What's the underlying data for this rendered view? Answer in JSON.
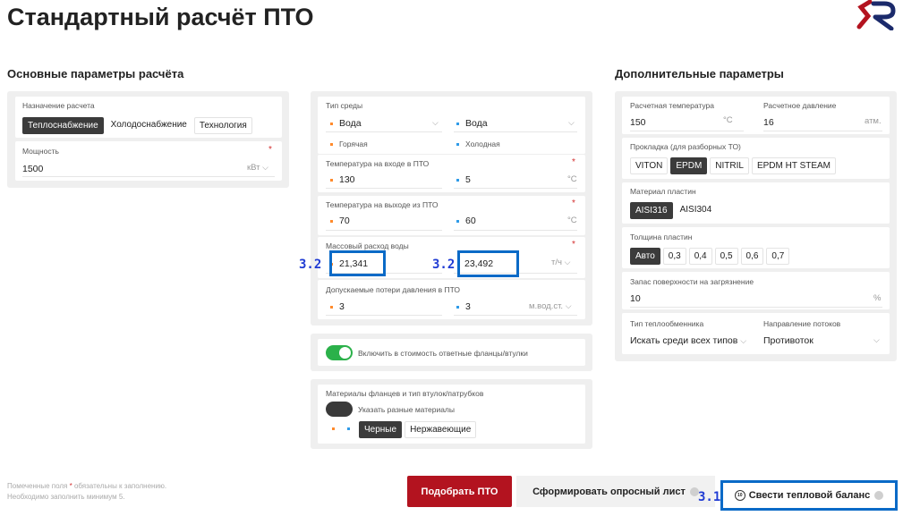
{
  "page": {
    "title": "Стандартный расчёт ПТО"
  },
  "brand": {
    "accent": "#b3131f",
    "dark": "#1b2a6b",
    "highlight": "#0a6ac7"
  },
  "main_params": {
    "heading": "Основные параметры расчёта",
    "purpose_label": "Назначение расчета",
    "purpose_options": [
      "Теплоснабжение",
      "Холодоснабжение",
      "Технология"
    ],
    "purpose_selected": "Теплоснабжение",
    "power_label": "Мощность",
    "power_value": "1500",
    "power_unit": "кВт"
  },
  "media": {
    "medium_label": "Тип среды",
    "hot_medium": "Вода",
    "cold_medium": "Вода",
    "hot_label": "Горячая",
    "cold_label": "Холодная",
    "inlet_label": "Температура на входе в ПТО",
    "inlet_hot": "130",
    "inlet_cold": "5",
    "temp_unit": "°C",
    "outlet_label": "Температура на выходе из ПТО",
    "outlet_hot": "70",
    "outlet_cold": "60",
    "flow_label": "Массовый расход воды",
    "flow_hot": "21,341",
    "flow_cold": "23,492",
    "flow_unit": "т/ч",
    "pressure_loss_label": "Допускаемые потери давления в ПТО",
    "pressure_loss_hot": "3",
    "pressure_loss_cold": "3",
    "pressure_loss_unit": "м.вод.ст.",
    "required_mark": "*"
  },
  "flanges": {
    "toggle_label": "Включить в стоимость ответные фланцы/втулки",
    "toggle_on": true,
    "materials_label": "Материалы фланцев и тип втулок/патрубков",
    "diff_materials_label": "Указать разные материалы",
    "diff_on": false,
    "options": [
      "Черные",
      "Нержавеющие"
    ],
    "selected": "Черные"
  },
  "extra_params": {
    "heading": "Дополнительные параметры",
    "design_temp_label": "Расчетная температура",
    "design_temp_value": "150",
    "design_temp_unit": "°C",
    "design_pressure_label": "Расчетное давление",
    "design_pressure_value": "16",
    "design_pressure_unit": "атм.",
    "gasket_label": "Прокладка (для разборных ТО)",
    "gasket_options": [
      "VITON",
      "EPDM",
      "NITRIL",
      "EPDM HT STEAM"
    ],
    "gasket_selected": "EPDM",
    "plate_material_label": "Материал пластин",
    "plate_material_options": [
      "AISI316",
      "AISI304"
    ],
    "plate_material_selected": "AISI316",
    "thickness_label": "Толщина пластин",
    "thickness_options": [
      "Авто",
      "0,3",
      "0,4",
      "0,5",
      "0,6",
      "0,7"
    ],
    "thickness_selected": "Авто",
    "fouling_label": "Запас поверхности на загрязнение",
    "fouling_value": "10",
    "fouling_unit": "%",
    "hx_type_label": "Тип теплообменника",
    "hx_type_value": "Искать среди всех типов",
    "flow_dir_label": "Направление потоков",
    "flow_dir_value": "Противоток"
  },
  "footer": {
    "note_prefix": "Помеченные поля ",
    "note_star": "*",
    "note_suffix": " обязательны к заполнению.",
    "note_line2": "Необходимо заполнить минимум 5.",
    "select_btn": "Подобрать ПТО",
    "questionnaire_btn": "Сформировать опросный лист",
    "balance_btn": "Свести тепловой баланс",
    "balance_icon_text": "10"
  },
  "annotations": {
    "step_flow": "3.2",
    "step_balance": "3.1"
  }
}
